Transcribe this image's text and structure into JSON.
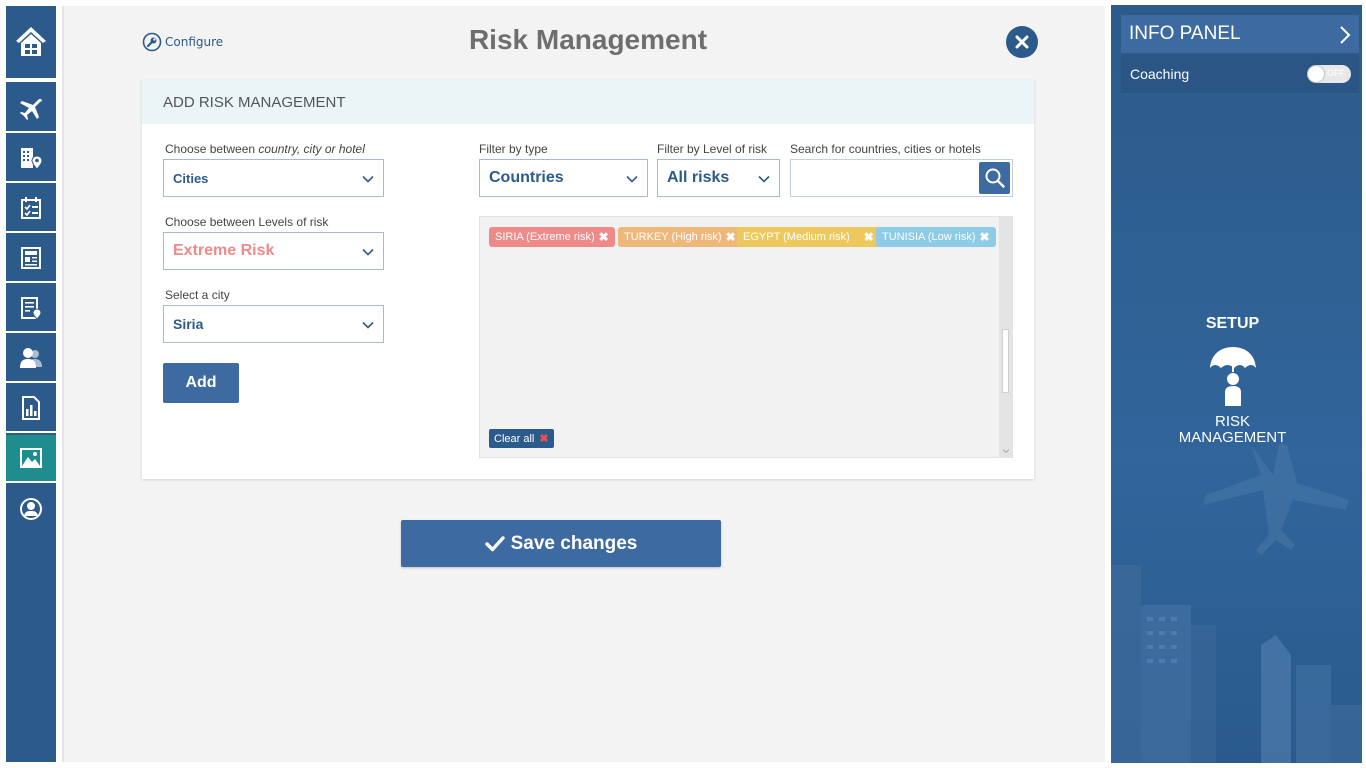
{
  "header": {
    "configure_label": "Configure",
    "title": "Risk Management"
  },
  "form": {
    "section_title": "ADD RISK MANAGEMENT",
    "choose_label_prefix": "Choose between ",
    "choose_label_italic": "country, city or hotel",
    "choose_value": "Cities",
    "levels_label": "Choose between Levels of risk",
    "levels_value": "Extreme Risk",
    "city_label": "Select a city",
    "city_value": "Siria",
    "add_label": "Add"
  },
  "filters": {
    "type_label": "Filter by type",
    "type_value": "Countries",
    "level_label": "Filter by Level of risk",
    "level_value": "All risks",
    "search_label": "Search for countries, cities or hotels",
    "search_value": ""
  },
  "tags": [
    {
      "label": "SIRIA (Extreme risk)",
      "color": "#ef8a8a"
    },
    {
      "label": "TURKEY (High risk)",
      "color": "#efb87b"
    },
    {
      "label": "EGYPT (Medium risk)",
      "color": "#edc95d"
    },
    {
      "label": "TUNISIA (Low risk)",
      "color": "#8ecbe6"
    }
  ],
  "clear_all_label": "Clear all",
  "save_label": "Save changes",
  "info_panel": {
    "title": "INFO PANEL",
    "coaching_label": "Coaching",
    "coaching_state": "OFF",
    "setup_title": "SETUP",
    "setup_caption": "RISK\nMANAGEMENT"
  },
  "nav": {
    "items": [
      "home-icon",
      "plane-icon",
      "hotel-location-icon",
      "calendar-checklist-icon",
      "newspaper-icon",
      "report-location-icon",
      "users-icon",
      "report-chart-icon",
      "image-icon",
      "profile-icon"
    ],
    "active": "image-icon"
  },
  "colors": {
    "primary": "#2c5a8a",
    "button": "#3d6aa0",
    "active_nav": "#1f8c8e",
    "extreme": "#ef8a8a",
    "high": "#efb87b",
    "medium": "#edc95d",
    "low": "#8ecbe6"
  }
}
